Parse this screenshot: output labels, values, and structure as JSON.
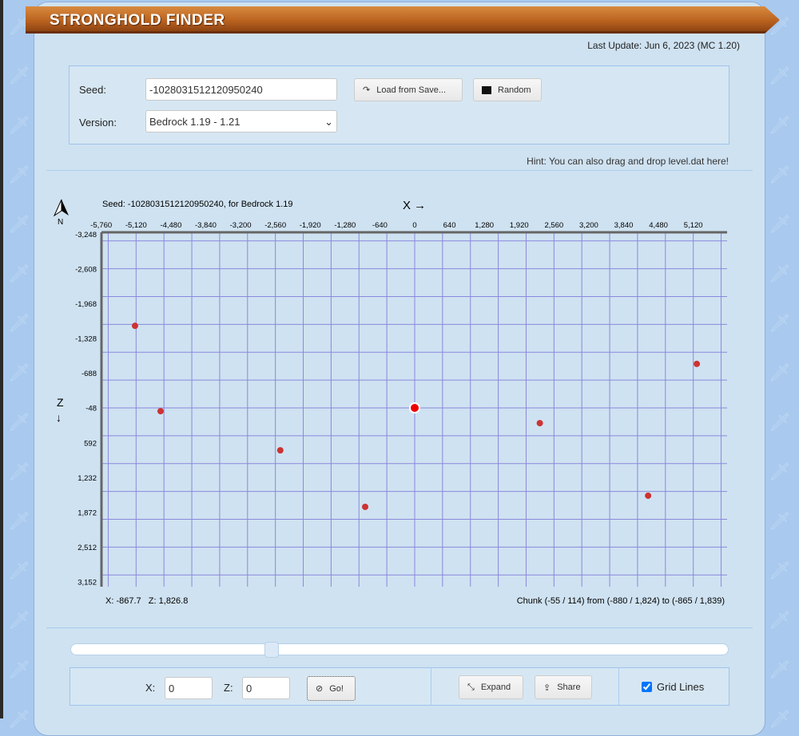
{
  "header": {
    "title": "STRONGHOLD FINDER",
    "last_update": "Last Update: Jun 6, 2023 (MC 1.20)"
  },
  "form": {
    "seed_label": "Seed:",
    "seed_value": "-1028031512120950240",
    "version_label": "Version:",
    "version_value": "Bedrock 1.19 - 1.21",
    "load_label": "Load from Save...",
    "random_label": "Random",
    "hint": "Hint: You can also drag and drop level.dat here!"
  },
  "map": {
    "caption": "Seed: -1028031512120950240, for Bedrock 1.19",
    "x_axis": "X →",
    "z_axis": "Z",
    "z_arrow": "↓",
    "north": "N",
    "cursor": "X: -867.7   Z: 1,826.8",
    "chunk": "Chunk (-55 / 114) from (-880 / 1,824) to (-865 / 1,839)"
  },
  "chart_data": {
    "type": "scatter",
    "x_ticks": [
      -5760,
      -5120,
      -4480,
      -3840,
      -3200,
      -2560,
      -1920,
      -1280,
      -640,
      0,
      640,
      1280,
      1920,
      2560,
      3200,
      3840,
      4480,
      5120
    ],
    "z_ticks": [
      -3248,
      -2608,
      -1968,
      -1328,
      -688,
      -48,
      592,
      1232,
      1872,
      2512,
      3152
    ],
    "grid": true,
    "center": {
      "x": 0,
      "z": 0
    },
    "strongholds": [
      {
        "x": -5140,
        "z": -1510
      },
      {
        "x": -4670,
        "z": 60
      },
      {
        "x": -2470,
        "z": 780
      },
      {
        "x": -910,
        "z": 1820
      },
      {
        "x": 2300,
        "z": 280
      },
      {
        "x": 4290,
        "z": 1615
      },
      {
        "x": 5185,
        "z": -810
      }
    ],
    "point_color": "#cc3333",
    "center_color": "#ee0000"
  },
  "slider": {
    "value": 0.3
  },
  "controls": {
    "x_label": "X:",
    "x_value": "0",
    "z_label": "Z:",
    "z_value": "0",
    "go_label": "Go!",
    "expand_label": "Expand",
    "share_label": "Share",
    "grid_label": "Grid Lines",
    "grid_checked": true
  }
}
